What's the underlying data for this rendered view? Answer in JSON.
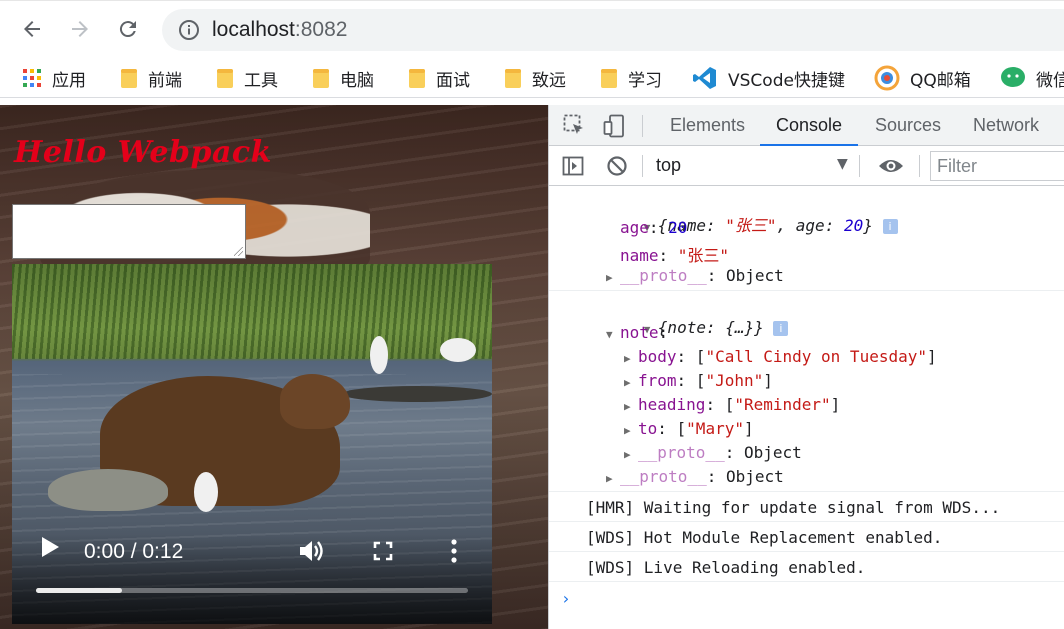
{
  "browser": {
    "url_host": "localhost",
    "url_port": ":8082"
  },
  "bookmarks": [
    {
      "label": "应用",
      "icon": "apps-grid-icon"
    },
    {
      "label": "前端",
      "icon": "folder-icon"
    },
    {
      "label": "工具",
      "icon": "folder-icon"
    },
    {
      "label": "电脑",
      "icon": "folder-icon"
    },
    {
      "label": "面试",
      "icon": "folder-icon"
    },
    {
      "label": "致远",
      "icon": "folder-icon"
    },
    {
      "label": "学习",
      "icon": "folder-icon"
    },
    {
      "label": "VSCode快捷键",
      "icon": "vscode-icon"
    },
    {
      "label": "QQ邮箱",
      "icon": "qq-mail-icon"
    },
    {
      "label": "微信",
      "icon": "wechat-icon"
    }
  ],
  "page": {
    "title": "Hello Webpack",
    "video": {
      "time": "0:00 / 0:12",
      "progress_fraction": 0.2
    }
  },
  "devtools": {
    "tabs": [
      "Elements",
      "Console",
      "Sources",
      "Network"
    ],
    "active_tab": "Console",
    "context": "top",
    "filter_placeholder": "Filter",
    "log1": {
      "summary_key1": "name",
      "summary_val1": "\"张三\"",
      "summary_key2": "age",
      "summary_val2": "20",
      "age_key": "age",
      "age_val": "20",
      "name_key": "name",
      "name_val": "\"张三\"",
      "proto_key": "__proto__",
      "proto_val": "Object"
    },
    "log2": {
      "summary": "{note: {…}}",
      "note_key": "note",
      "body_key": "body",
      "body_val": "\"Call Cindy on Tuesday\"",
      "from_key": "from",
      "from_val": "\"John\"",
      "heading_key": "heading",
      "heading_val": "\"Reminder\"",
      "to_key": "to",
      "to_val": "\"Mary\"",
      "inner_proto_key": "__proto__",
      "inner_proto_val": "Object",
      "proto_key": "__proto__",
      "proto_val": "Object"
    },
    "messages": [
      "[HMR] Waiting for update signal from WDS...",
      "[WDS] Hot Module Replacement enabled.",
      "[WDS] Live Reloading enabled."
    ],
    "prompt": "›"
  },
  "colors": {
    "accent": "#1a73e8",
    "title_red": "#e4001a",
    "console_key": "#881391",
    "console_string": "#c41a16",
    "console_number": "#1c00cf"
  }
}
